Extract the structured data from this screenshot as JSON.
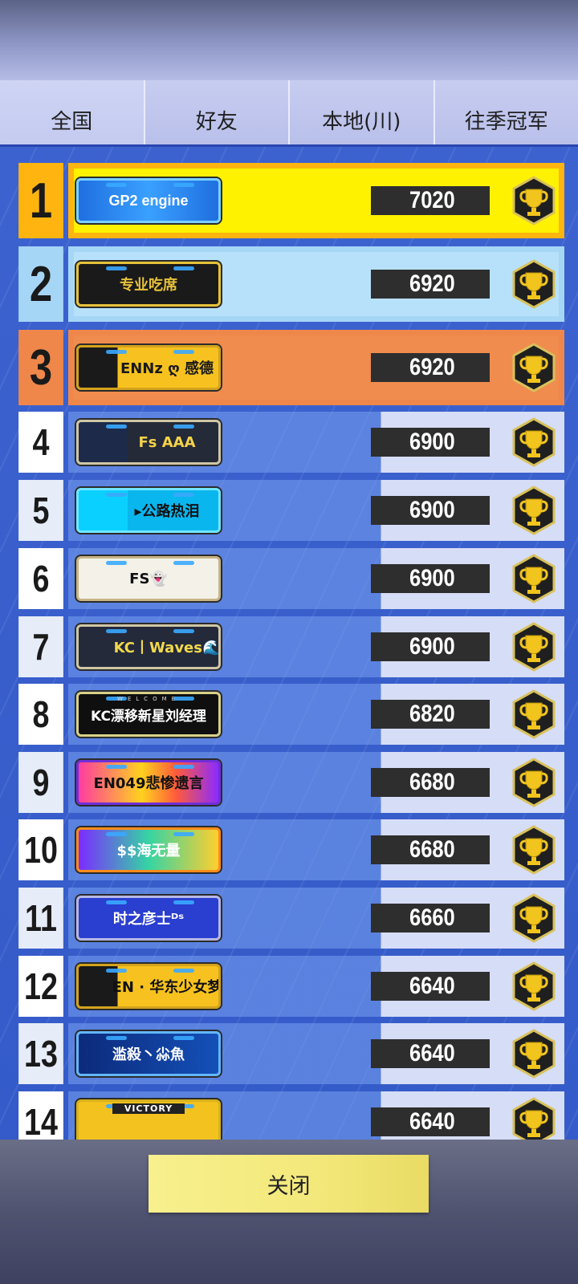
{
  "tabs": [
    {
      "label": "全国"
    },
    {
      "label": "好友"
    },
    {
      "label": "本地(川)"
    },
    {
      "label": "往季冠军"
    }
  ],
  "leaderboard": [
    {
      "rank": "1",
      "name": "GP2 engine",
      "score": "7020"
    },
    {
      "rank": "2",
      "name": "专业吃席",
      "score": "6920"
    },
    {
      "rank": "3",
      "name": "ENNz ღ 感德",
      "score": "6920"
    },
    {
      "rank": "4",
      "name": "Fs  AAA",
      "score": "6900"
    },
    {
      "rank": "5",
      "name": "▸公路热泪",
      "score": "6900"
    },
    {
      "rank": "6",
      "name": "FS👻",
      "score": "6900"
    },
    {
      "rank": "7",
      "name": "KC丨Waves🌊",
      "score": "6900"
    },
    {
      "rank": "8",
      "name": "KC漂移新星刘经理",
      "score": "6820"
    },
    {
      "rank": "9",
      "name": "EN049悲惨遗言",
      "score": "6680"
    },
    {
      "rank": "10",
      "name": "$$海无量",
      "score": "6680"
    },
    {
      "rank": "11",
      "name": "时之彦士ᴰˢ",
      "score": "6660"
    },
    {
      "rank": "12",
      "name": "EN · 华东少女梦",
      "score": "6640"
    },
    {
      "rank": "13",
      "name": "滥殺丶尛魚",
      "score": "6640"
    },
    {
      "rank": "14",
      "name": "",
      "score": "6640"
    }
  ],
  "plate_extras": {
    "welcome": "WELCOME",
    "victory": "VICTORY"
  },
  "close_label": "关闭",
  "colors": {
    "gold": "#fff200",
    "silver": "#b7e1fb",
    "bronze": "#f08c4e",
    "default_row": "#5b8ae6",
    "rank_box_default": "#ffffff"
  },
  "icons": {
    "trophy": "trophy-icon"
  }
}
